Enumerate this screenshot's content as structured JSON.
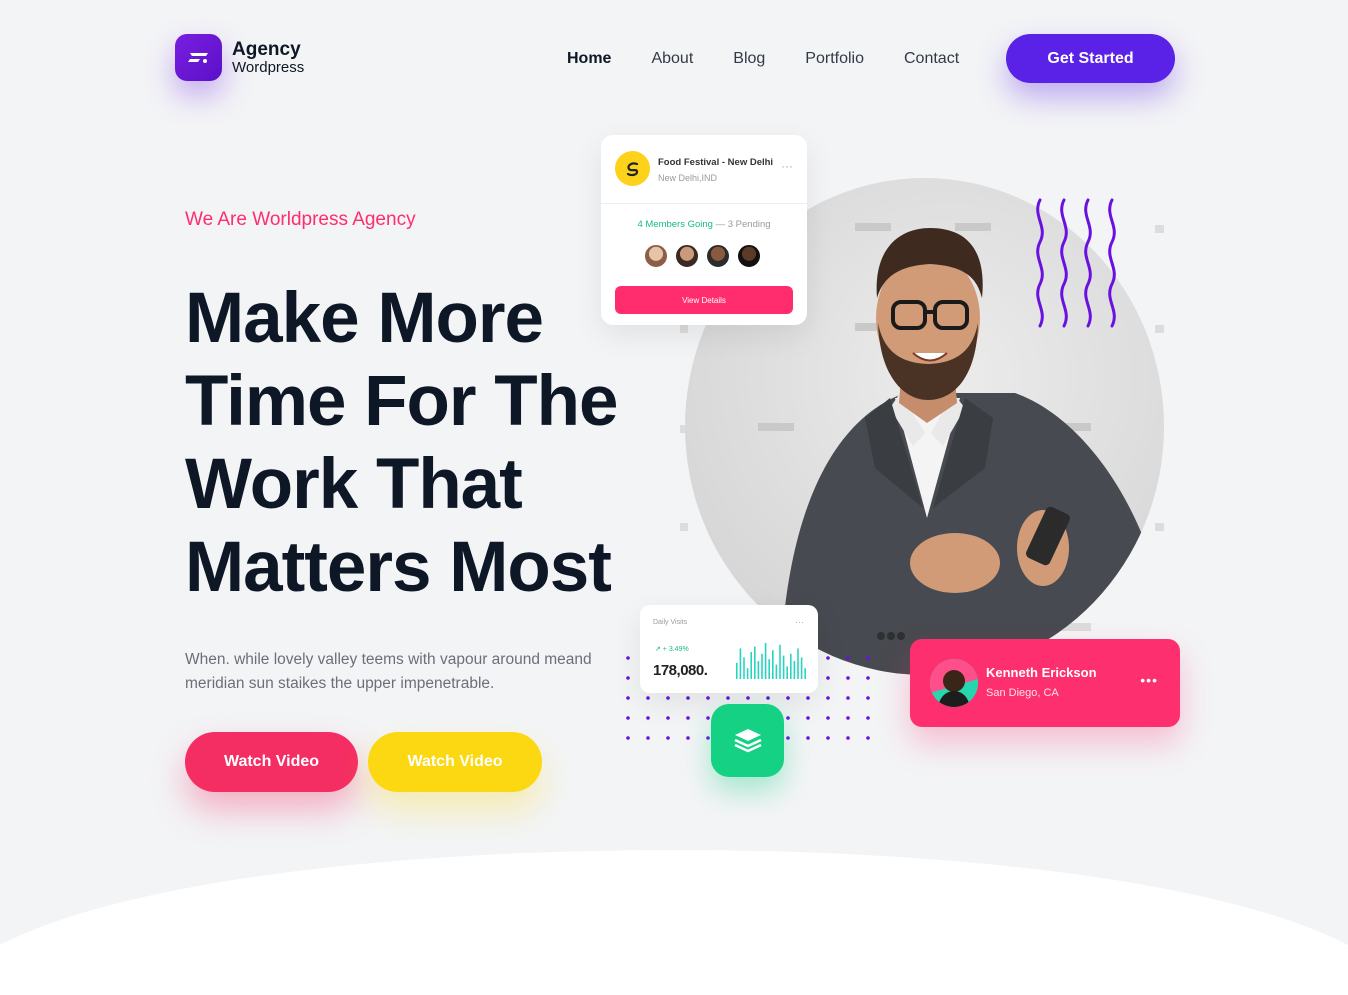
{
  "brand": {
    "title": "Agency",
    "subtitle": "Wordpress"
  },
  "nav": {
    "items": [
      "Home",
      "About",
      "Blog",
      "Portfolio",
      "Contact"
    ],
    "active": "Home",
    "cta": "Get Started"
  },
  "hero": {
    "eyebrow": "We Are Worldpress Agency",
    "headline": [
      "Make More",
      "Time For The",
      "Work That",
      "Matters Most"
    ],
    "lead": "When. while lovely valley teems with vapour around meand meridian sun staikes the upper impenetrable.",
    "buttons": {
      "primary": "Watch Video",
      "secondary": "Watch Video"
    }
  },
  "event_card": {
    "title": "Food Festival - New Delhi",
    "location": "New Delhi,IND",
    "members_going": "4 Members Going",
    "pending": "3 Pending",
    "separator": " — ",
    "more": "···",
    "button": "View Details"
  },
  "stats_card": {
    "title": "Daily Visits",
    "delta": "↗ + 3.49%",
    "value": "178,080.",
    "more": "···",
    "bars": [
      0.45,
      0.85,
      0.6,
      0.3,
      0.75,
      0.9,
      0.5,
      0.7,
      1.0,
      0.55,
      0.8,
      0.4,
      0.95,
      0.65,
      0.35,
      0.7,
      0.5,
      0.85,
      0.6,
      0.3
    ]
  },
  "profile_card": {
    "name": "Kenneth Erickson",
    "location": "San Diego, CA",
    "more": "•••"
  },
  "colors": {
    "brand": "#5a21e6",
    "accent_pink": "#ff2d6e",
    "accent_yellow": "#fbd811",
    "accent_green": "#15d184",
    "text_dark": "#0e1726",
    "background": "#f3f4f6"
  },
  "icons": {
    "logo": "brand-logo-icon",
    "event": "festival-logo-icon",
    "layers": "layers-icon",
    "more": "more-dots-icon"
  }
}
